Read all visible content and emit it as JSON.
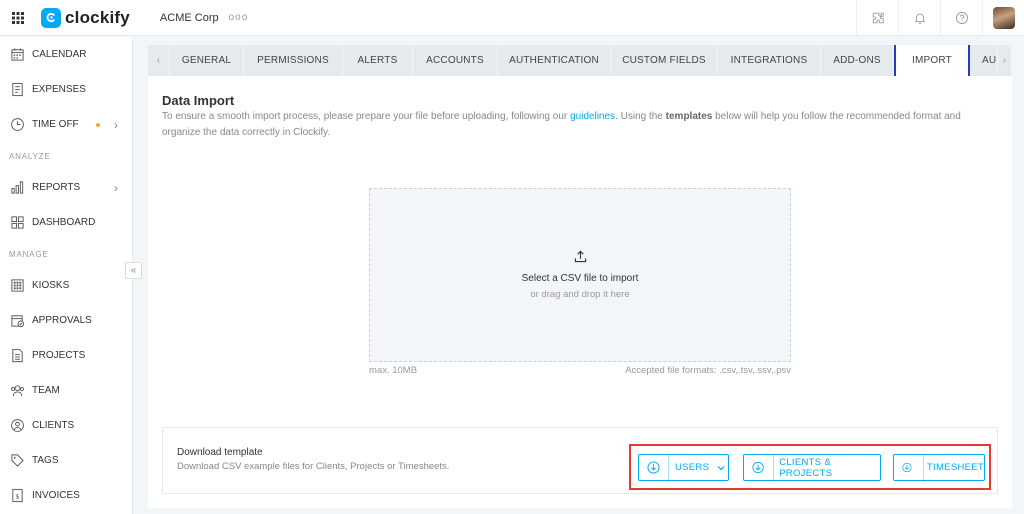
{
  "app": {
    "name": "clockify",
    "workspace": "ACME Corp",
    "workspace_more": "ooo"
  },
  "sidebar": {
    "items_top": [
      {
        "label": "CALENDAR",
        "icon": "calendar-icon"
      },
      {
        "label": "EXPENSES",
        "icon": "expenses-icon"
      },
      {
        "label": "TIME OFF",
        "icon": "clock-icon",
        "has_dot": true,
        "has_chevron": true
      }
    ],
    "section_analyze": "ANALYZE",
    "items_analyze": [
      {
        "label": "REPORTS",
        "icon": "reports-icon",
        "has_chevron": true
      },
      {
        "label": "DASHBOARD",
        "icon": "dashboard-icon"
      }
    ],
    "section_manage": "MANAGE",
    "items_manage": [
      {
        "label": "KIOSKS",
        "icon": "kiosk-icon"
      },
      {
        "label": "APPROVALS",
        "icon": "approvals-icon"
      },
      {
        "label": "PROJECTS",
        "icon": "projects-icon"
      },
      {
        "label": "TEAM",
        "icon": "team-icon"
      },
      {
        "label": "CLIENTS",
        "icon": "clients-icon"
      },
      {
        "label": "TAGS",
        "icon": "tag-icon"
      },
      {
        "label": "INVOICES",
        "icon": "invoices-icon"
      }
    ],
    "collapse_glyph": "«"
  },
  "tabs": {
    "prev_glyph": "‹",
    "next_glyph": "›",
    "items": [
      {
        "label": "GENERAL",
        "active": false
      },
      {
        "label": "PERMISSIONS",
        "active": false
      },
      {
        "label": "ALERTS",
        "active": false
      },
      {
        "label": "ACCOUNTS",
        "active": false
      },
      {
        "label": "AUTHENTICATION",
        "active": false
      },
      {
        "label": "CUSTOM FIELDS",
        "active": false
      },
      {
        "label": "INTEGRATIONS",
        "active": false
      },
      {
        "label": "ADD-ONS",
        "active": false
      },
      {
        "label": "IMPORT",
        "active": true
      },
      {
        "label": "AU",
        "active": false
      }
    ]
  },
  "import": {
    "title": "Data Import",
    "desc_part1": "To ensure a smooth import process, please prepare your file before uploading, following our ",
    "desc_link": "guidelines",
    "desc_part2": ". Using the ",
    "desc_bold": "templates",
    "desc_part3": " below will help you follow the recommended format and organize the data correctly in Clockify.",
    "dropzone_main": "Select a CSV file to import",
    "dropzone_sub": "or drag and drop it here",
    "max_size": "max. 10MB",
    "accepted_formats": "Accepted file formats: .csv,.tsv,.ssv,.psv"
  },
  "template": {
    "title": "Download template",
    "subtitle": "Download CSV example files for Clients, Projects or Timesheets.",
    "buttons": {
      "users": "USERS",
      "clients_projects": "CLIENTS & PROJECTS",
      "timesheet": "TIMESHEET"
    }
  },
  "colors": {
    "accent": "#03a9f4",
    "active_tab_border": "#2a3cb5",
    "highlight": "#e53935"
  }
}
